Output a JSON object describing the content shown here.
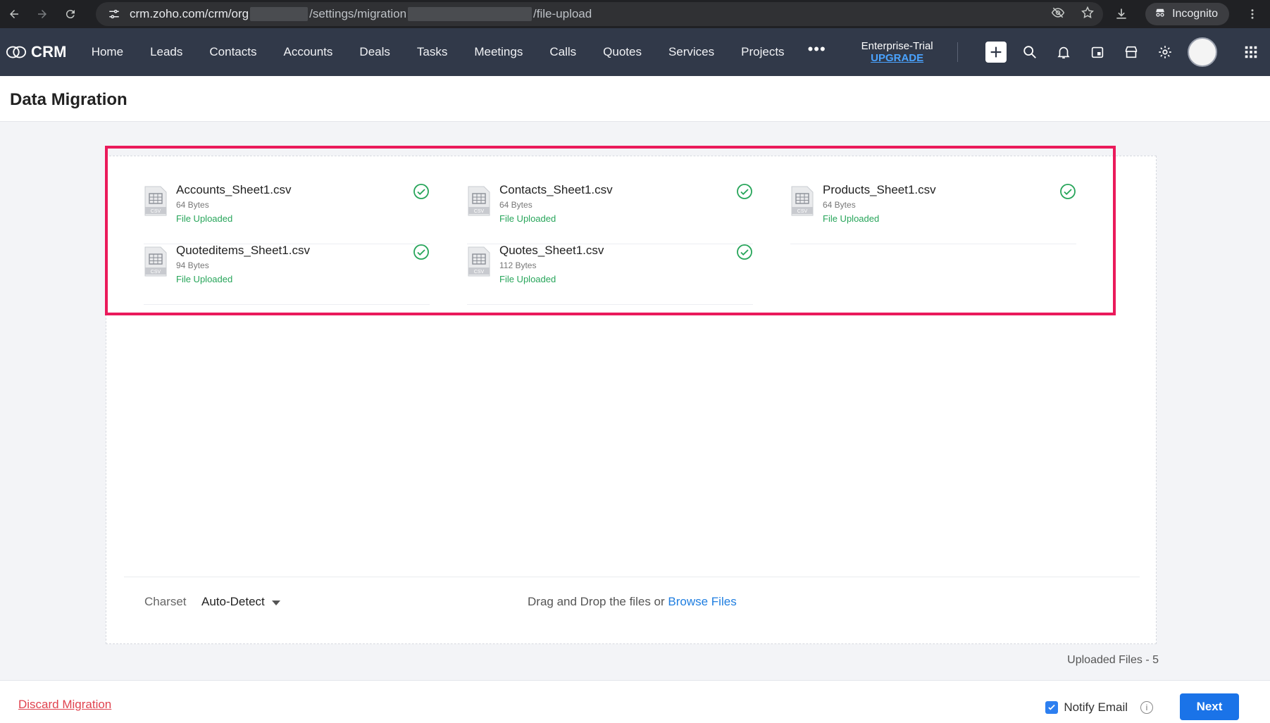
{
  "browser": {
    "url_part1": "crm.zoho.com/crm/org",
    "url_part2": "/settings/migration",
    "url_part3": "/file-upload",
    "incognito_label": "Incognito"
  },
  "crm": {
    "logo": "CRM",
    "nav": [
      "Home",
      "Leads",
      "Contacts",
      "Accounts",
      "Deals",
      "Tasks",
      "Meetings",
      "Calls",
      "Quotes",
      "Services",
      "Projects"
    ],
    "more": "•••",
    "plan": "Enterprise-Trial",
    "upgrade": "UPGRADE"
  },
  "page": {
    "title": "Data Migration"
  },
  "files": [
    {
      "name": "Accounts_Sheet1.csv",
      "size": "64 Bytes",
      "status": "File Uploaded"
    },
    {
      "name": "Contacts_Sheet1.csv",
      "size": "64 Bytes",
      "status": "File Uploaded"
    },
    {
      "name": "Products_Sheet1.csv",
      "size": "64 Bytes",
      "status": "File Uploaded"
    },
    {
      "name": "Quoteditems_Sheet1.csv",
      "size": "94 Bytes",
      "status": "File Uploaded"
    },
    {
      "name": "Quotes_Sheet1.csv",
      "size": "112 Bytes",
      "status": "File Uploaded"
    }
  ],
  "file_icon_label": "CSV",
  "upload": {
    "charset_label": "Charset",
    "charset_value": "Auto-Detect",
    "drop_text": "Drag and Drop the files or ",
    "browse": "Browse Files",
    "uploaded_count": "Uploaded Files - 5"
  },
  "footer": {
    "discard": "Discard Migration",
    "notify": "Notify Email",
    "info": "i",
    "next": "Next"
  },
  "colors": {
    "accent": "#1a73e8",
    "success": "#27a55a",
    "highlight": "#ea1a5b",
    "topbar": "#313949"
  }
}
